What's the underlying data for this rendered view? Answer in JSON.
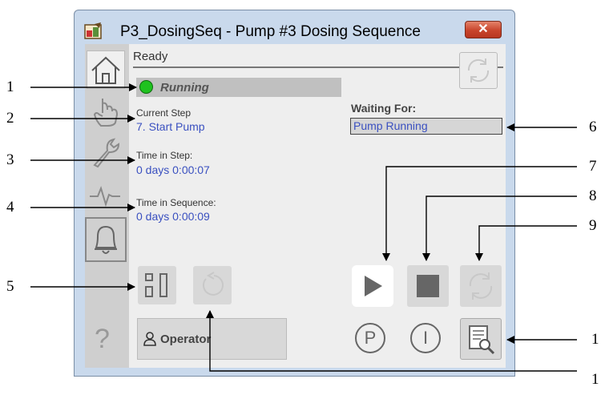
{
  "window": {
    "title": "P3_DosingSeq - Pump #3 Dosing Sequence",
    "close_label": "✕"
  },
  "status": {
    "ready": "Ready",
    "running": "Running"
  },
  "current_step": {
    "label": "Current Step",
    "value": "7. Start Pump"
  },
  "time_in_step": {
    "label": "Time in Step:",
    "value": "0 days  0:00:07"
  },
  "time_in_sequence": {
    "label": "Time in Sequence:",
    "value": "0 days  0:00:09"
  },
  "waiting_for": {
    "label": "Waiting For:",
    "value": "Pump Running"
  },
  "operator_button": {
    "label": "Operator"
  },
  "help": {
    "label": "?"
  },
  "p_button": {
    "label": "P"
  },
  "i_button": {
    "label": "I"
  },
  "callouts": [
    "1",
    "2",
    "3",
    "4",
    "5",
    "6",
    "7",
    "8",
    "9",
    "1",
    "1"
  ],
  "colors": {
    "running_led": "#1fc21f",
    "value_text": "#3a50c0",
    "close_red": "#c8452c"
  }
}
